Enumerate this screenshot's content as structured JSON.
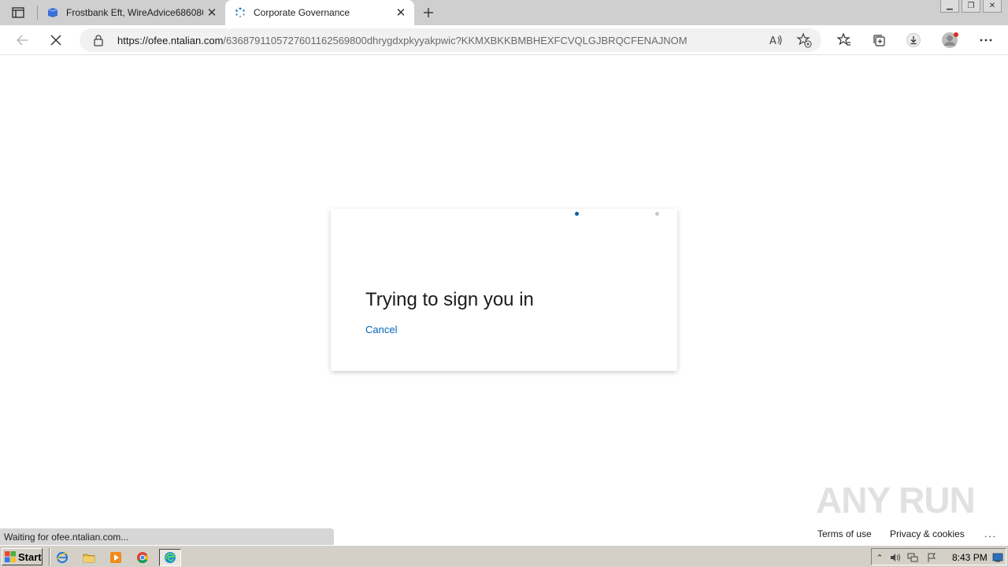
{
  "browser": {
    "tabs": [
      {
        "title": "Frostbank Eft, WireAdvice686086",
        "active": false
      },
      {
        "title": "Corporate Governance",
        "active": true
      }
    ],
    "url_host": "https://ofee.ntalian.com",
    "url_path": "/6368791105727601162569800dhrygdxpkyyakpwic?KKMXBKKBMBHEXFCVQLGJBRQCFENAJNOM",
    "status_text": "Waiting for ofee.ntalian.com..."
  },
  "page": {
    "heading": "Trying to sign you in",
    "cancel_label": "Cancel",
    "footer": {
      "terms": "Terms of use",
      "privacy": "Privacy & cookies",
      "more": "..."
    },
    "watermark": "ANY RUN"
  },
  "taskbar": {
    "start_label": "Start",
    "clock": "8:43 PM"
  },
  "colors": {
    "accent": "#0067b8",
    "progress_dot": "#0f5c9c",
    "tab_bar": "#cfcfcf",
    "taskbar": "#d4d0c8"
  },
  "icons": {
    "tab_actions": "tab-actions-icon",
    "back": "back-arrow-icon",
    "stop": "stop-loading-icon",
    "lock": "lock-icon",
    "read_aloud": "read-aloud-icon",
    "add_favorite": "add-favorite-icon",
    "favorites": "favorites-icon",
    "collections": "collections-icon",
    "downloads": "downloads-icon",
    "profile": "profile-icon",
    "menu": "more-menu-icon"
  }
}
